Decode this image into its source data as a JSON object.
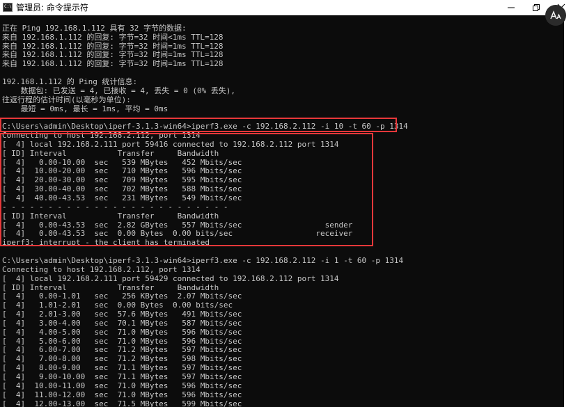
{
  "window": {
    "title": "管理员: 命令提示符",
    "icon_label": "C:\\",
    "controls": [
      "minimize-icon",
      "maximize-icon",
      "close-icon"
    ],
    "overlay_icon": "font-aa-icon"
  },
  "colors": {
    "console_bg": "#0c0c0c",
    "console_fg": "#c8c8c8",
    "highlight": "#e8383a"
  },
  "console": {
    "lines": [
      "",
      "正在 Ping 192.168.1.112 具有 32 字节的数据:",
      "来自 192.168.1.112 的回复: 字节=32 时间<1ms TTL=128",
      "来自 192.168.1.112 的回复: 字节=32 时间=1ms TTL=128",
      "来自 192.168.1.112 的回复: 字节=32 时间=1ms TTL=128",
      "来自 192.168.1.112 的回复: 字节=32 时间=1ms TTL=128",
      "",
      "192.168.1.112 的 Ping 统计信息:",
      "    数据包: 已发送 = 4, 已接收 = 4, 丢失 = 0 (0% 丢失),",
      "往返行程的估计时间(以毫秒为单位):",
      "    最短 = 0ms, 最长 = 1ms, 平均 = 0ms",
      "",
      "C:\\Users\\admin\\Desktop\\iperf-3.1.3-win64>iperf3.exe -c 192.168.2.112 -i 10 -t 60 -p 1314",
      "Connecting to host 192.168.2.112, port 1314",
      "[  4] local 192.168.2.111 port 59416 connected to 192.168.2.112 port 1314",
      "[ ID] Interval           Transfer     Bandwidth",
      "[  4]   0.00-10.00  sec   539 MBytes   452 Mbits/sec",
      "[  4]  10.00-20.00  sec   710 MBytes   596 Mbits/sec",
      "[  4]  20.00-30.00  sec   709 MBytes   595 Mbits/sec",
      "[  4]  30.00-40.00  sec   702 MBytes   588 Mbits/sec",
      "[  4]  40.00-43.53  sec   231 MBytes   549 Mbits/sec",
      "- - - - - - - - - - - - - - - - - - - - - - - - -",
      "[ ID] Interval           Transfer     Bandwidth",
      "[  4]   0.00-43.53  sec  2.82 GBytes   557 Mbits/sec                  sender",
      "[  4]   0.00-43.53  sec  0.00 Bytes  0.00 bits/sec                  receiver",
      "iperf3: interrupt - the client has terminated",
      "",
      "C:\\Users\\admin\\Desktop\\iperf-3.1.3-win64>iperf3.exe -c 192.168.2.112 -i 1 -t 60 -p 1314",
      "Connecting to host 192.168.2.112, port 1314",
      "[  4] local 192.168.2.111 port 59429 connected to 192.168.2.112 port 1314",
      "[ ID] Interval           Transfer     Bandwidth",
      "[  4]   0.00-1.01   sec   256 KBytes  2.07 Mbits/sec",
      "[  4]   1.01-2.01   sec  0.00 Bytes  0.00 bits/sec",
      "[  4]   2.01-3.00   sec  57.6 MBytes   491 Mbits/sec",
      "[  4]   3.00-4.00   sec  70.1 MBytes   587 Mbits/sec",
      "[  4]   4.00-5.00   sec  71.0 MBytes   596 Mbits/sec",
      "[  4]   5.00-6.00   sec  71.0 MBytes   596 Mbits/sec",
      "[  4]   6.00-7.00   sec  71.2 MBytes   597 Mbits/sec",
      "[  4]   7.00-8.00   sec  71.2 MBytes   598 Mbits/sec",
      "[  4]   8.00-9.00   sec  71.1 MBytes   597 Mbits/sec",
      "[  4]   9.00-10.00  sec  71.1 MBytes   597 Mbits/sec",
      "[  4]  10.00-11.00  sec  71.0 MBytes   596 Mbits/sec",
      "[  4]  11.00-12.00  sec  71.0 MBytes   596 Mbits/sec",
      "[  4]  12.00-13.00  sec  71.5 MBytes   599 Mbits/sec"
    ]
  }
}
